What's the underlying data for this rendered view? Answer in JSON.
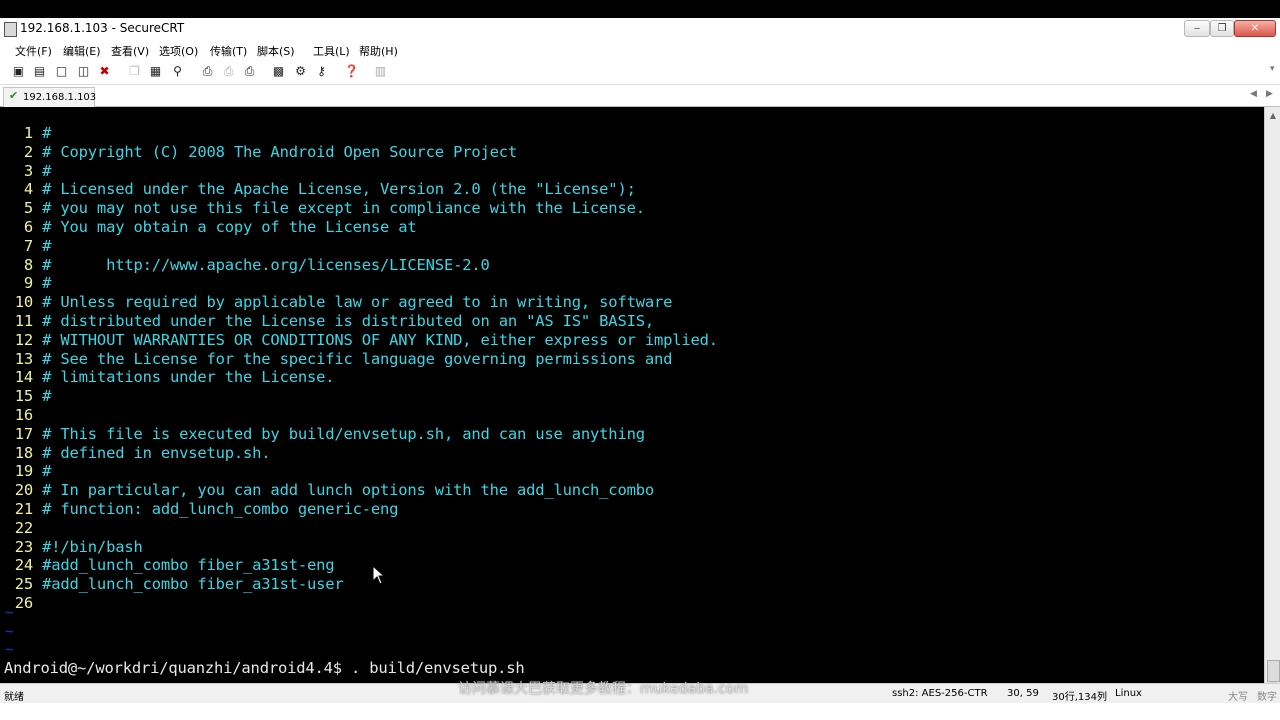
{
  "window": {
    "title": "192.168.1.103 - SecureCRT",
    "controls": {
      "minimize": "‒",
      "maximize": "❐",
      "close": "✕"
    }
  },
  "menu": [
    "文件(F)",
    "编辑(E)",
    "查看(V)",
    "选项(O)",
    "传输(T)",
    "脚本(S)",
    "工具(L)",
    "帮助(H)"
  ],
  "toolbar": {
    "icons": [
      "connect-icon",
      "quick-connect-icon",
      "connect-tab-icon",
      "reconnect-icon",
      "disconnect-icon",
      "copy-icon",
      "paste-icon",
      "find-icon",
      "print-icon",
      "print-selection-icon",
      "print-setup-icon",
      "session-options-icon",
      "global-options-icon",
      "keymap-icon",
      "help-icon",
      "lock-icon"
    ]
  },
  "tab": {
    "label": "192.168.1.103",
    "status": "connected"
  },
  "terminal": {
    "colors": {
      "background": "#000000",
      "line_number": "#f0f0a0",
      "comment": "#39d6e6",
      "text": "#e6e6e6",
      "tilde": "#2233ee"
    },
    "lines": [
      {
        "num": "1",
        "text": "#"
      },
      {
        "num": "2",
        "text": "# Copyright (C) 2008 The Android Open Source Project"
      },
      {
        "num": "3",
        "text": "#"
      },
      {
        "num": "4",
        "text": "# Licensed under the Apache License, Version 2.0 (the \"License\");"
      },
      {
        "num": "5",
        "text": "# you may not use this file except in compliance with the License."
      },
      {
        "num": "6",
        "text": "# You may obtain a copy of the License at"
      },
      {
        "num": "7",
        "text": "#"
      },
      {
        "num": "8",
        "text": "#      http://www.apache.org/licenses/LICENSE-2.0"
      },
      {
        "num": "9",
        "text": "#"
      },
      {
        "num": "10",
        "text": "# Unless required by applicable law or agreed to in writing, software"
      },
      {
        "num": "11",
        "text": "# distributed under the License is distributed on an \"AS IS\" BASIS,"
      },
      {
        "num": "12",
        "text": "# WITHOUT WARRANTIES OR CONDITIONS OF ANY KIND, either express or implied."
      },
      {
        "num": "13",
        "text": "# See the License for the specific language governing permissions and"
      },
      {
        "num": "14",
        "text": "# limitations under the License."
      },
      {
        "num": "15",
        "text": "#"
      },
      {
        "num": "16",
        "text": ""
      },
      {
        "num": "17",
        "text": "# This file is executed by build/envsetup.sh, and can use anything"
      },
      {
        "num": "18",
        "text": "# defined in envsetup.sh."
      },
      {
        "num": "19",
        "text": "#"
      },
      {
        "num": "20",
        "text": "# In particular, you can add lunch options with the add_lunch_combo"
      },
      {
        "num": "21",
        "text": "# function: add_lunch_combo generic-eng"
      },
      {
        "num": "22",
        "text": ""
      },
      {
        "num": "23",
        "text": "#!/bin/bash"
      },
      {
        "num": "24",
        "text": "#add_lunch_combo fiber_a31st-eng"
      },
      {
        "num": "25",
        "text": "#add_lunch_combo fiber_a31st-user"
      },
      {
        "num": "26",
        "text": ""
      }
    ],
    "tildes": [
      "~",
      "~",
      "~"
    ],
    "prompt": "Android@~/workdri/quanzhi/android4.4$ . build/envsetup.sh"
  },
  "statusbar": {
    "ready": "就绪",
    "cipher": "ssh2: AES-256-CTR",
    "position": "30, 59",
    "size": "30行,134列",
    "os": "Linux",
    "caps": "大写",
    "num": "数字"
  },
  "watermark": "访问慕课大巴获取更多教程：mukedaba.com"
}
